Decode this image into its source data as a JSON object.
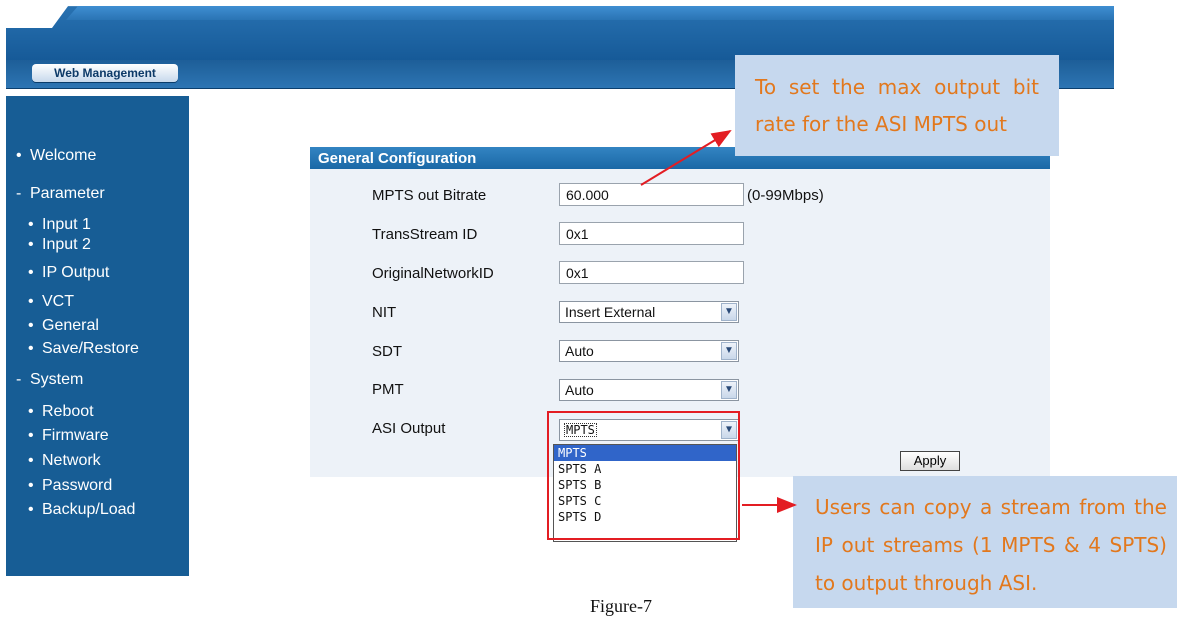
{
  "header": {
    "tab_label": "Web Management"
  },
  "sidebar": {
    "items": [
      {
        "label": "Welcome",
        "bullet": "•"
      },
      {
        "label": "Parameter",
        "bullet": "-"
      },
      {
        "label": "Input 1",
        "bullet": "•"
      },
      {
        "label": "Input 2",
        "bullet": "•"
      },
      {
        "label": "IP Output",
        "bullet": "•"
      },
      {
        "label": "VCT",
        "bullet": "•"
      },
      {
        "label": "General",
        "bullet": "•"
      },
      {
        "label": "Save/Restore",
        "bullet": "•"
      },
      {
        "label": "System",
        "bullet": "-"
      },
      {
        "label": "Reboot",
        "bullet": "•"
      },
      {
        "label": "Firmware",
        "bullet": "•"
      },
      {
        "label": "Network",
        "bullet": "•"
      },
      {
        "label": "Password",
        "bullet": "•"
      },
      {
        "label": "Backup/Load",
        "bullet": "•"
      }
    ]
  },
  "form": {
    "title": "General Configuration",
    "fields": {
      "bitrate": {
        "label": "MPTS out Bitrate",
        "value": "60.000",
        "unit": "(0-99Mbps)"
      },
      "transstream": {
        "label": "TransStream ID",
        "value": "0x1"
      },
      "orignet": {
        "label": "OriginalNetworkID",
        "value": "0x1"
      },
      "nit": {
        "label": "NIT",
        "value": "Insert External"
      },
      "sdt": {
        "label": "SDT",
        "value": "Auto"
      },
      "pmt": {
        "label": "PMT",
        "value": "Auto"
      },
      "asi": {
        "label": "ASI Output",
        "value": "MPTS",
        "options": [
          "MPTS",
          "SPTS A",
          "SPTS B",
          "SPTS C",
          "SPTS D"
        ]
      }
    },
    "apply_label": "Apply"
  },
  "callouts": {
    "top": "To set the max output bit rate for the ASI MPTS out",
    "bottom": "Users can copy a stream from the IP out streams (1 MPTS & 4 SPTS) to output through ASI."
  },
  "figure_caption": "Figure-7",
  "colors": {
    "sidebar": "#175d95",
    "panel_header": "#1a68a6",
    "callout_bg": "#c6d8ee",
    "callout_text": "#e2781d",
    "highlight": "#e31d23",
    "selected_option": "#3065c9"
  },
  "icons": {
    "dropdown": "chevron-down-icon",
    "arrow": "red-arrow-icon"
  }
}
